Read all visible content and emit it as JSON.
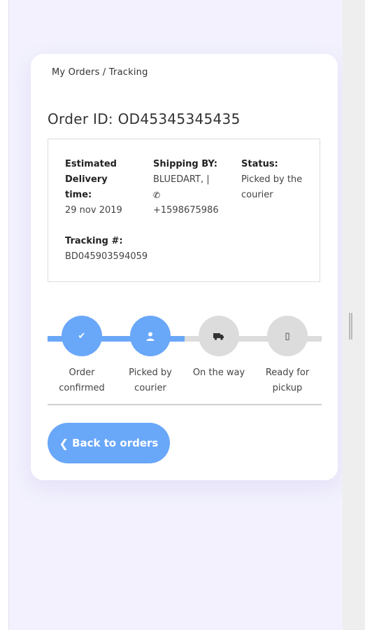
{
  "breadcrumb": "My Orders / Tracking",
  "order_title": "Order ID: OD45345345435",
  "info": {
    "delivery_label": "Estimated Delivery time:",
    "delivery_value": "29 nov 2019",
    "shipping_label": "Shipping BY:",
    "shipping_carrier": "BLUEDART, |",
    "shipping_phone_icon": "phone-icon",
    "shipping_phone": "+1598675986",
    "status_label": "Status:",
    "status_value": "Picked by the courier",
    "tracking_label": "Tracking #:",
    "tracking_value": "BD045903594059"
  },
  "steps": [
    {
      "label": "Order confirmed",
      "icon": "check-icon",
      "glyph": "✔",
      "done": true
    },
    {
      "label": "Picked by courier",
      "icon": "user-icon",
      "glyph": "👤",
      "done": true
    },
    {
      "label": "On the way",
      "icon": "truck-icon",
      "glyph": "🚚",
      "done": false
    },
    {
      "label": "Ready for pickup",
      "icon": "box-icon",
      "glyph": "▯",
      "done": false
    }
  ],
  "back_button": {
    "label": "Back to orders",
    "icon": "chevron-left-icon",
    "glyph": "❮"
  },
  "colors": {
    "accent": "#69a7f9",
    "pending": "#dcdcdc",
    "page_bg": "#f2f1fd"
  }
}
